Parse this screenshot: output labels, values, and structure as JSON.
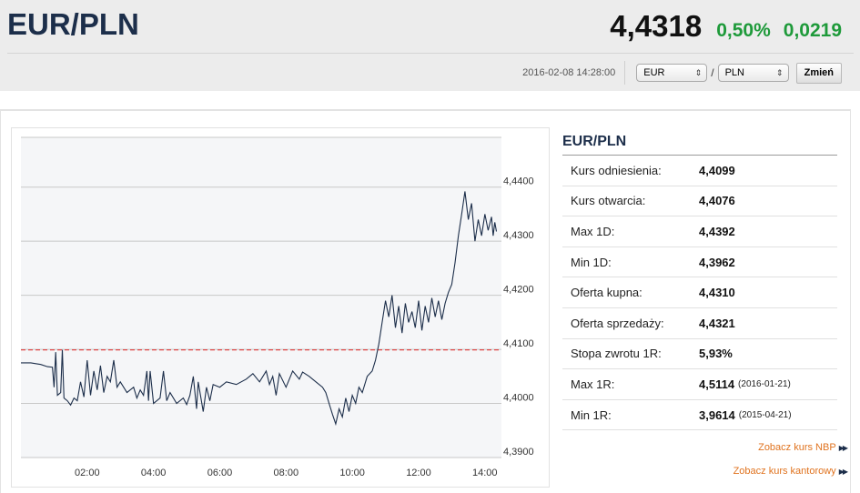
{
  "header": {
    "pair": "EUR/PLN",
    "rate": "4,4318",
    "change_pct": "0,50%",
    "change_abs": "0,0219",
    "timestamp": "2016-02-08 14:28:00",
    "from_currency": "EUR",
    "separator": "/",
    "to_currency": "PLN",
    "change_button": "Zmień",
    "positive_color": "#1e9a3a"
  },
  "info": {
    "title": "EUR/PLN",
    "rows": [
      {
        "label": "Kurs odniesienia:",
        "value": "4,4099",
        "date": ""
      },
      {
        "label": "Kurs otwarcia:",
        "value": "4,4076",
        "date": ""
      },
      {
        "label": "Max 1D:",
        "value": "4,4392",
        "date": ""
      },
      {
        "label": "Min 1D:",
        "value": "4,3962",
        "date": ""
      },
      {
        "label": "Oferta kupna:",
        "value": "4,4310",
        "date": ""
      },
      {
        "label": "Oferta sprzedaży:",
        "value": "4,4321",
        "date": ""
      },
      {
        "label": "Stopa zwrotu 1R:",
        "value": "5,93%",
        "date": ""
      },
      {
        "label": "Max 1R:",
        "value": "4,5114",
        "date": "(2016-01-21)"
      },
      {
        "label": "Min 1R:",
        "value": "3,9614",
        "date": "(2015-04-21)"
      }
    ],
    "links": [
      "Zobacz kurs NBP",
      "Zobacz kurs kantorowy"
    ],
    "link_icon": "double-triangle-right"
  },
  "chart_data": {
    "type": "line",
    "title": "",
    "xlabel": "",
    "ylabel": "",
    "x_ticks": [
      "02:00",
      "04:00",
      "06:00",
      "08:00",
      "10:00",
      "12:00",
      "14:00"
    ],
    "y_ticks": [
      "4,3900",
      "4,4000",
      "4,4100",
      "4,4200",
      "4,4300",
      "4,4400"
    ],
    "ylim": [
      4.39,
      4.4492
    ],
    "xlim_hours": [
      0.0,
      14.5
    ],
    "reference_value": 4.4099,
    "reference_color": "#e03a3a",
    "line_color": "#1c2e4a",
    "grid": true,
    "series": [
      {
        "name": "",
        "points": [
          [
            0.0,
            4.4075
          ],
          [
            0.3,
            4.4075
          ],
          [
            0.6,
            4.4072
          ],
          [
            0.8,
            4.4068
          ],
          [
            0.95,
            4.4067
          ],
          [
            1.0,
            4.403
          ],
          [
            1.05,
            4.4095
          ],
          [
            1.1,
            4.4015
          ],
          [
            1.2,
            4.402
          ],
          [
            1.25,
            4.4099
          ],
          [
            1.3,
            4.401
          ],
          [
            1.4,
            4.4005
          ],
          [
            1.5,
            4.3997
          ],
          [
            1.6,
            4.401
          ],
          [
            1.7,
            4.4005
          ],
          [
            1.8,
            4.404
          ],
          [
            1.9,
            4.4012
          ],
          [
            2.0,
            4.408
          ],
          [
            2.1,
            4.4015
          ],
          [
            2.2,
            4.406
          ],
          [
            2.3,
            4.4025
          ],
          [
            2.4,
            4.407
          ],
          [
            2.5,
            4.402
          ],
          [
            2.6,
            4.405
          ],
          [
            2.7,
            4.404
          ],
          [
            2.8,
            4.408
          ],
          [
            2.9,
            4.403
          ],
          [
            3.0,
            4.404
          ],
          [
            3.2,
            4.402
          ],
          [
            3.4,
            4.403
          ],
          [
            3.5,
            4.401
          ],
          [
            3.6,
            4.4025
          ],
          [
            3.7,
            4.4015
          ],
          [
            3.8,
            4.406
          ],
          [
            3.85,
            4.4005
          ],
          [
            3.9,
            4.406
          ],
          [
            4.0,
            4.4
          ],
          [
            4.2,
            4.401
          ],
          [
            4.3,
            4.406
          ],
          [
            4.4,
            4.4005
          ],
          [
            4.5,
            4.402
          ],
          [
            4.7,
            4.4
          ],
          [
            4.9,
            4.401
          ],
          [
            5.0,
            4.3998
          ],
          [
            5.1,
            4.4015
          ],
          [
            5.2,
            4.405
          ],
          [
            5.3,
            4.399
          ],
          [
            5.35,
            4.404
          ],
          [
            5.5,
            4.3985
          ],
          [
            5.6,
            4.403
          ],
          [
            5.7,
            4.4005
          ],
          [
            5.8,
            4.4035
          ],
          [
            6.0,
            4.403
          ],
          [
            6.2,
            4.404
          ],
          [
            6.5,
            4.4035
          ],
          [
            6.8,
            4.4045
          ],
          [
            7.0,
            4.4055
          ],
          [
            7.2,
            4.404
          ],
          [
            7.4,
            4.406
          ],
          [
            7.5,
            4.4035
          ],
          [
            7.6,
            4.405
          ],
          [
            7.7,
            4.4015
          ],
          [
            7.8,
            4.4055
          ],
          [
            8.0,
            4.403
          ],
          [
            8.2,
            4.406
          ],
          [
            8.4,
            4.4045
          ],
          [
            8.5,
            4.4058
          ],
          [
            8.7,
            4.405
          ],
          [
            8.9,
            4.404
          ],
          [
            9.1,
            4.403
          ],
          [
            9.2,
            4.402
          ],
          [
            9.3,
            4.4
          ],
          [
            9.4,
            4.398
          ],
          [
            9.5,
            4.3962
          ],
          [
            9.6,
            4.399
          ],
          [
            9.7,
            4.3975
          ],
          [
            9.8,
            4.401
          ],
          [
            9.9,
            4.3985
          ],
          [
            10.0,
            4.4015
          ],
          [
            10.1,
            4.4
          ],
          [
            10.2,
            4.403
          ],
          [
            10.3,
            4.402
          ],
          [
            10.45,
            4.405
          ],
          [
            10.6,
            4.406
          ],
          [
            10.7,
            4.408
          ],
          [
            10.8,
            4.411
          ],
          [
            10.9,
            4.415
          ],
          [
            11.0,
            4.419
          ],
          [
            11.1,
            4.416
          ],
          [
            11.2,
            4.42
          ],
          [
            11.3,
            4.414
          ],
          [
            11.4,
            4.418
          ],
          [
            11.5,
            4.413
          ],
          [
            11.6,
            4.4185
          ],
          [
            11.7,
            4.415
          ],
          [
            11.8,
            4.417
          ],
          [
            11.9,
            4.414
          ],
          [
            12.0,
            4.419
          ],
          [
            12.1,
            4.4135
          ],
          [
            12.2,
            4.418
          ],
          [
            12.3,
            4.415
          ],
          [
            12.4,
            4.4195
          ],
          [
            12.5,
            4.416
          ],
          [
            12.6,
            4.419
          ],
          [
            12.7,
            4.4155
          ],
          [
            12.8,
            4.4185
          ],
          [
            12.9,
            4.4205
          ],
          [
            13.0,
            4.422
          ],
          [
            13.1,
            4.426
          ],
          [
            13.2,
            4.431
          ],
          [
            13.3,
            4.435
          ],
          [
            13.4,
            4.4392
          ],
          [
            13.5,
            4.434
          ],
          [
            13.6,
            4.437
          ],
          [
            13.7,
            4.43
          ],
          [
            13.8,
            4.434
          ],
          [
            13.9,
            4.431
          ],
          [
            14.0,
            4.435
          ],
          [
            14.1,
            4.432
          ],
          [
            14.2,
            4.4345
          ],
          [
            14.25,
            4.431
          ],
          [
            14.3,
            4.4335
          ],
          [
            14.35,
            4.4318
          ]
        ]
      }
    ]
  }
}
